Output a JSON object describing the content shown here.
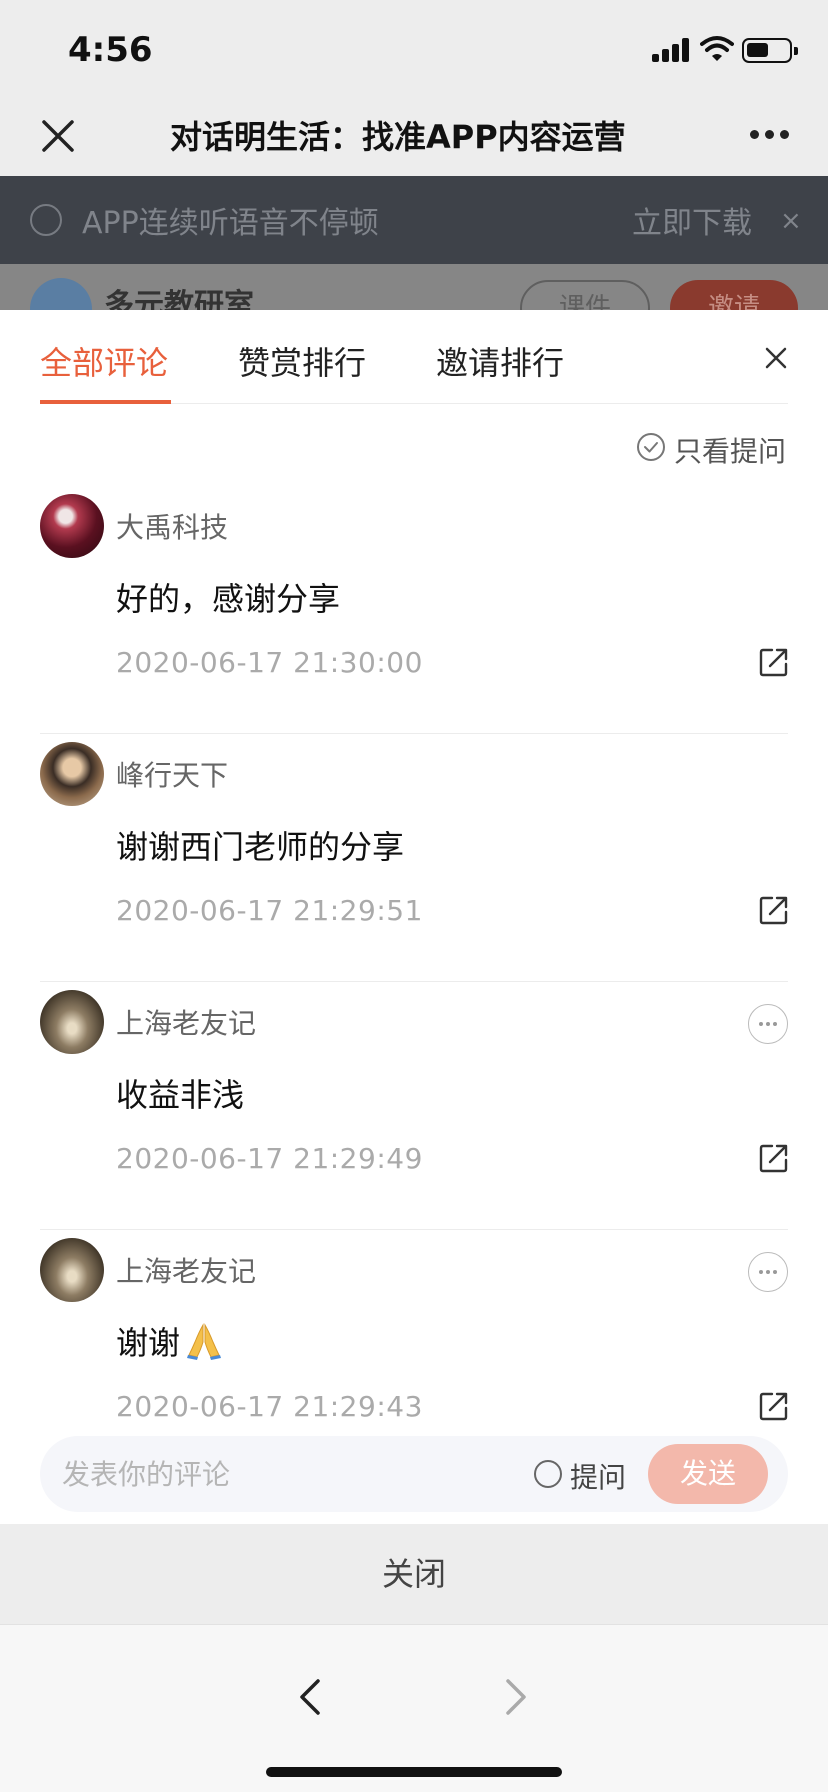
{
  "status": {
    "time": "4:56"
  },
  "nav": {
    "title": "对话明生活：找准APP内容运营"
  },
  "background": {
    "banner_text": "APP连续听语音不停顿",
    "banner_download": "立即下载",
    "banner_close": "×",
    "channel_name": "多元教研室",
    "course_button": "课件",
    "invite_button": "邀请"
  },
  "tabs": [
    "全部评论",
    "赞赏排行",
    "邀请排行"
  ],
  "active_tab": 0,
  "filter_label": "只看提问",
  "comments": [
    {
      "username": "大禹科技",
      "content": "好的，感谢分享",
      "timestamp": "2020-06-17 21:30:00",
      "avatar": "avatar-flowers",
      "has_more": false,
      "has_emoji": false
    },
    {
      "username": "峰行天下",
      "content": "谢谢西门老师的分享",
      "timestamp": "2020-06-17 21:29:51",
      "avatar": "avatar-man",
      "has_more": false,
      "has_emoji": false
    },
    {
      "username": "上海老友记",
      "content": "收益非浅",
      "timestamp": "2020-06-17 21:29:49",
      "avatar": "avatar-street",
      "has_more": true,
      "has_emoji": false
    },
    {
      "username": "上海老友记",
      "content": "谢谢",
      "timestamp": "2020-06-17 21:29:43",
      "avatar": "avatar-street",
      "has_more": true,
      "has_emoji": true,
      "emoji": "folded-hands-icon"
    }
  ],
  "composer": {
    "placeholder": "发表你的评论",
    "ask_label": "提问",
    "send_label": "发送"
  },
  "close_label": "关闭",
  "colors": {
    "accent": "#e8603c",
    "send_disabled": "#f3b8ab"
  }
}
